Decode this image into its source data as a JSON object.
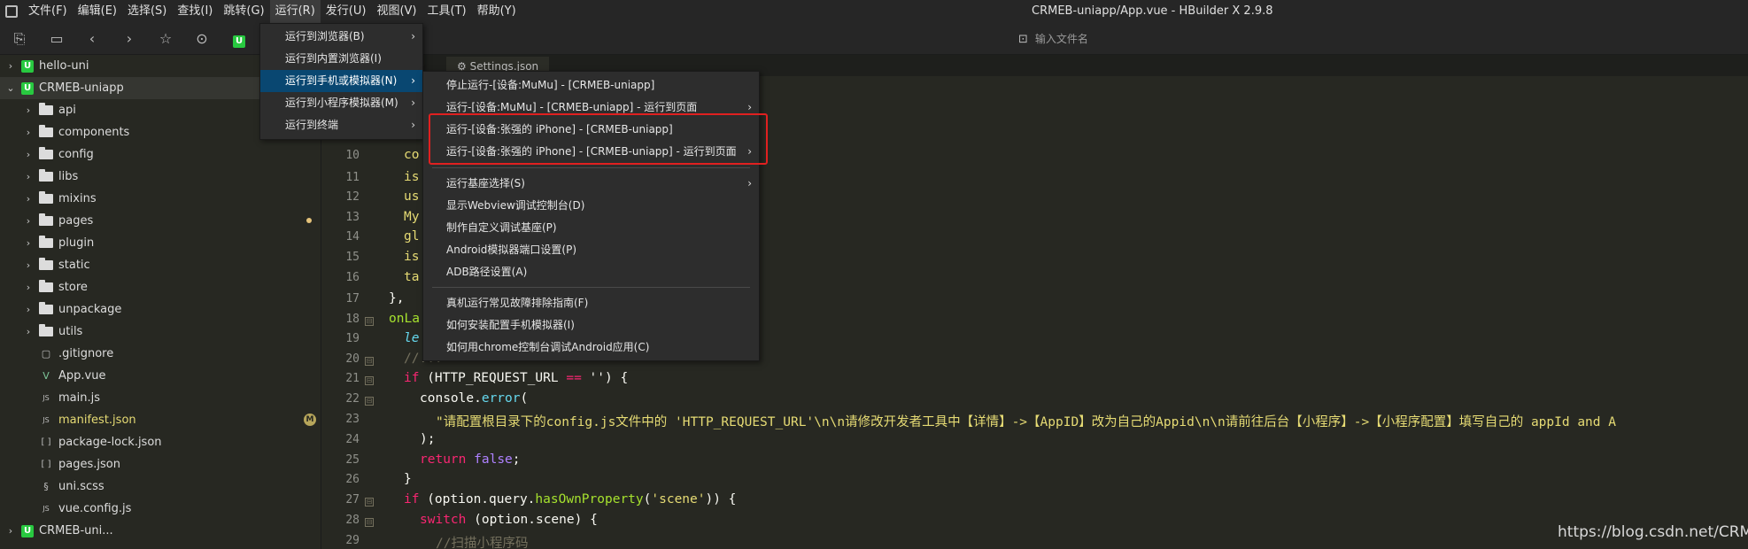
{
  "app": {
    "window_title": "CRMEB-uniapp/App.vue - HBuilder X 2.9.8"
  },
  "menubar": {
    "items": [
      {
        "label": "文件(F)"
      },
      {
        "label": "编辑(E)"
      },
      {
        "label": "选择(S)"
      },
      {
        "label": "查找(I)"
      },
      {
        "label": "跳转(G)"
      },
      {
        "label": "运行(R)"
      },
      {
        "label": "发行(U)"
      },
      {
        "label": "视图(V)"
      },
      {
        "label": "工具(T)"
      },
      {
        "label": "帮助(Y)"
      }
    ]
  },
  "toolbar": {
    "filename_placeholder": "输入文件名",
    "icons": [
      "new-file-icon",
      "save-icon",
      "back-icon",
      "forward-icon",
      "star-icon",
      "run-icon",
      "uniapp-icon"
    ]
  },
  "sidebar": {
    "items": [
      {
        "label": "hello-uni",
        "type": "project",
        "expanded": false
      },
      {
        "label": "CRMEB-uniapp",
        "type": "project",
        "expanded": true
      },
      {
        "label": "api",
        "type": "folder"
      },
      {
        "label": "components",
        "type": "folder"
      },
      {
        "label": "config",
        "type": "folder"
      },
      {
        "label": "libs",
        "type": "folder"
      },
      {
        "label": "mixins",
        "type": "folder"
      },
      {
        "label": "pages",
        "type": "folder",
        "modified": true
      },
      {
        "label": "plugin",
        "type": "folder"
      },
      {
        "label": "static",
        "type": "folder"
      },
      {
        "label": "store",
        "type": "folder"
      },
      {
        "label": "unpackage",
        "type": "folder"
      },
      {
        "label": "utils",
        "type": "folder"
      },
      {
        "label": ".gitignore",
        "type": "file",
        "glyph": "▢"
      },
      {
        "label": "App.vue",
        "type": "file",
        "glyph": "V"
      },
      {
        "label": "main.js",
        "type": "file",
        "glyph": "JS"
      },
      {
        "label": "manifest.json",
        "type": "file",
        "glyph": "JS",
        "badge": "M"
      },
      {
        "label": "package-lock.json",
        "type": "file",
        "glyph": "[ ]"
      },
      {
        "label": "pages.json",
        "type": "file",
        "glyph": "[ ]"
      },
      {
        "label": "uni.scss",
        "type": "file",
        "glyph": "§"
      },
      {
        "label": "vue.config.js",
        "type": "file",
        "glyph": "JS"
      },
      {
        "label": "CRMEB-uni...",
        "type": "project",
        "expanded": false
      }
    ]
  },
  "editor": {
    "tab_label": "Settings.json",
    "line_numbers": [
      "10",
      "11",
      "12",
      "13",
      "14",
      "15",
      "16",
      "17",
      "18",
      "19",
      "20",
      "21",
      "22",
      "23",
      "24",
      "25",
      "26",
      "27",
      "28",
      "29"
    ],
    "code": {
      "l10": "co",
      "l11": "is",
      "l12": "us",
      "l13": "My",
      "l14": "gl",
      "l15": "is",
      "l16": "ta",
      "l17": "},",
      "l18": "onLa",
      "l19": "le",
      "l20": "//",
      "l20b": "...",
      "l21a": "if",
      "l21b": " (HTTP_REQUEST_URL ",
      "l21c": "==",
      "l21d": " '') {",
      "l22a": "console",
      "l22b": ".",
      "l22c": "error",
      "l22d": "(",
      "l23": "\"请配置根目录下的config.js文件中的 'HTTP_REQUEST_URL'\\n\\n请修改开发者工具中【详情】->【AppID】改为自己的Appid\\n\\n请前往后台【小程序】->【小程序配置】填写自己的 appId and A",
      "l24": ");",
      "l25a": "return",
      "l25b": "false",
      "l25c": ";",
      "l26": "}",
      "l27a": "if",
      "l27b": " (option.query.",
      "l27c": "hasOwnProperty",
      "l27d": "(",
      "l27e": "'scene'",
      "l27f": ")) {",
      "l28a": "switch",
      "l28b": " (option.scene) {",
      "l29": "//扫描小程序码"
    }
  },
  "run_menu": {
    "items": [
      {
        "label": "运行到浏览器(B)",
        "submenu": true
      },
      {
        "label": "运行到内置浏览器(I)",
        "submenu": false
      },
      {
        "label": "运行到手机或模拟器(N)",
        "submenu": true,
        "highlighted": true
      },
      {
        "label": "运行到小程序模拟器(M)",
        "submenu": true
      },
      {
        "label": "运行到终端",
        "submenu": true
      }
    ]
  },
  "device_menu": {
    "group1": [
      {
        "label": "停止运行-[设备:MuMu] - [CRMEB-uniapp]",
        "submenu": false
      },
      {
        "label": "运行-[设备:MuMu] - [CRMEB-uniapp] - 运行到页面",
        "submenu": true
      },
      {
        "label": "运行-[设备:张强的 iPhone] - [CRMEB-uniapp]",
        "submenu": false
      },
      {
        "label": "运行-[设备:张强的 iPhone] - [CRMEB-uniapp] - 运行到页面",
        "submenu": true
      }
    ],
    "group2": [
      {
        "label": "运行基座选择(S)",
        "submenu": true
      },
      {
        "label": "显示Webview调试控制台(D)",
        "submenu": false
      },
      {
        "label": "制作自定义调试基座(P)",
        "submenu": false
      },
      {
        "label": "Android模拟器端口设置(P)",
        "submenu": false
      },
      {
        "label": "ADB路径设置(A)",
        "submenu": false
      }
    ],
    "group3": [
      {
        "label": "真机运行常见故障排除指南(F)",
        "submenu": false
      },
      {
        "label": "如何安装配置手机模拟器(I)",
        "submenu": false
      },
      {
        "label": "如何用chrome控制台调试Android应用(C)",
        "submenu": false
      }
    ]
  },
  "watermark": "https://blog.csdn.net/CRMEB",
  "colors": {
    "highlight": "#094771",
    "annotation_box": "#e02020",
    "project_icon": "#28c940"
  }
}
